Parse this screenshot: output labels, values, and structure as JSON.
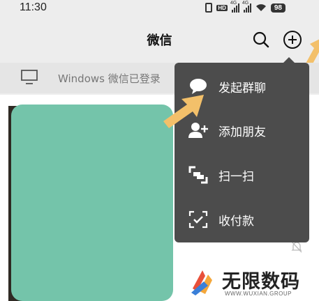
{
  "status_bar": {
    "time": "11:30",
    "hd_badge": "HD",
    "signal_1_label": "4G",
    "signal_2_label": "4G",
    "battery": "98"
  },
  "header": {
    "title": "微信",
    "icons": [
      "search-icon",
      "add-icon"
    ]
  },
  "login_banner": {
    "icon": "monitor-icon",
    "text": "Windows 微信已登录"
  },
  "menu": {
    "items": [
      {
        "label": "发起群聊",
        "icon": "chat-bubble-icon"
      },
      {
        "label": "添加朋友",
        "icon": "add-friend-icon"
      },
      {
        "label": "扫一扫",
        "icon": "scan-icon"
      },
      {
        "label": "收付款",
        "icon": "payment-icon"
      }
    ]
  },
  "watermark": {
    "title": "无限数码",
    "subtitle": "WWW.WUXIAN.GROUP"
  },
  "colors": {
    "menu_bg": "#4c4c4c",
    "page_bg": "#ededed",
    "annotation_arrow": "#f3c06a",
    "redaction_block": "#74c4aa"
  }
}
